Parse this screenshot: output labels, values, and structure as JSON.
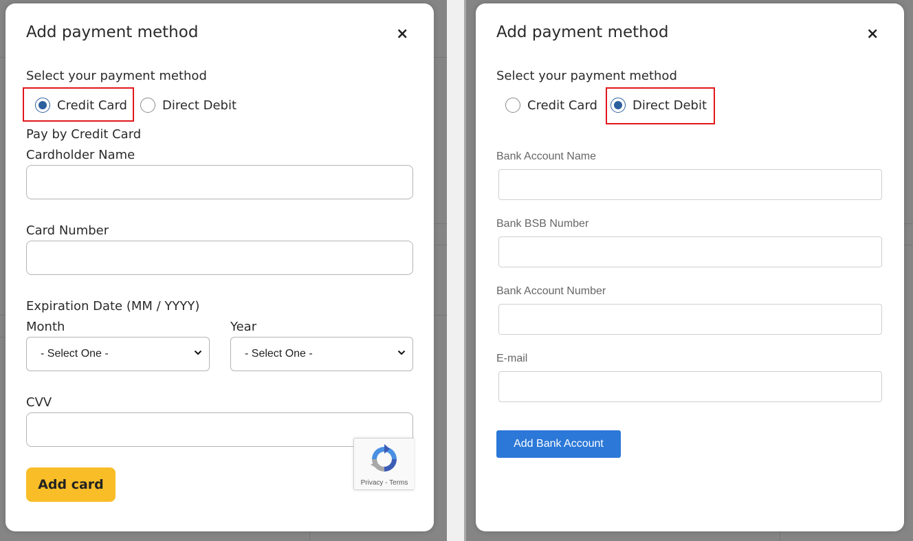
{
  "left_modal": {
    "title": "Add payment method",
    "close": "×",
    "prompt": "Select your payment method",
    "options": [
      {
        "label": "Credit Card",
        "selected": true
      },
      {
        "label": "Direct Debit",
        "selected": false
      }
    ],
    "section_title": "Pay by Credit Card",
    "cardholder_label": "Cardholder Name",
    "card_number_label": "Card Number",
    "expiration_label": "Expiration Date (MM / YYYY)",
    "month_label": "Month",
    "year_label": "Year",
    "month_value": "- Select One -",
    "year_value": "- Select One -",
    "cvv_label": "CVV",
    "submit_label": "Add card",
    "recaptcha": {
      "privacy": "Privacy",
      "sep": " - ",
      "terms": "Terms"
    }
  },
  "right_modal": {
    "title": "Add payment method",
    "close": "×",
    "prompt": "Select your payment method",
    "options": [
      {
        "label": "Credit Card",
        "selected": false
      },
      {
        "label": "Direct Debit",
        "selected": true
      }
    ],
    "bank_account_name_label": "Bank Account Name",
    "bank_bsb_label": "Bank BSB Number",
    "bank_account_number_label": "Bank Account Number",
    "email_label": "E-mail",
    "submit_label": "Add Bank Account"
  },
  "colors": {
    "highlight": "#e0161b",
    "radio_selected": "#2c5f9e",
    "add_card_button": "#f9bd27",
    "add_bank_button": "#2b78d8"
  }
}
